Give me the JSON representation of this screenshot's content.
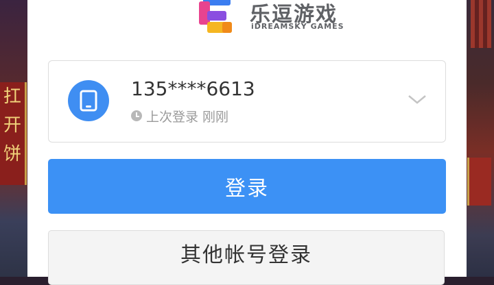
{
  "brand": {
    "name": "乐逗游戏",
    "subtitle": "iDREAMSKY GAMES",
    "logo_icon": "idreamsky-logo-icon"
  },
  "background": {
    "left_sign_chars": [
      "扛",
      "开",
      "饼"
    ]
  },
  "account": {
    "phone": "135****6613",
    "last_login_label": "上次登录 刚刚",
    "avatar_icon": "phone-icon",
    "expand_icon": "chevron-down-icon"
  },
  "buttons": {
    "login": "登录",
    "other_account": "其他帐号登录"
  },
  "colors": {
    "primary": "#3c91f5",
    "avatar": "#3f8ef2",
    "text": "#333333",
    "muted": "#9a9a9a"
  }
}
